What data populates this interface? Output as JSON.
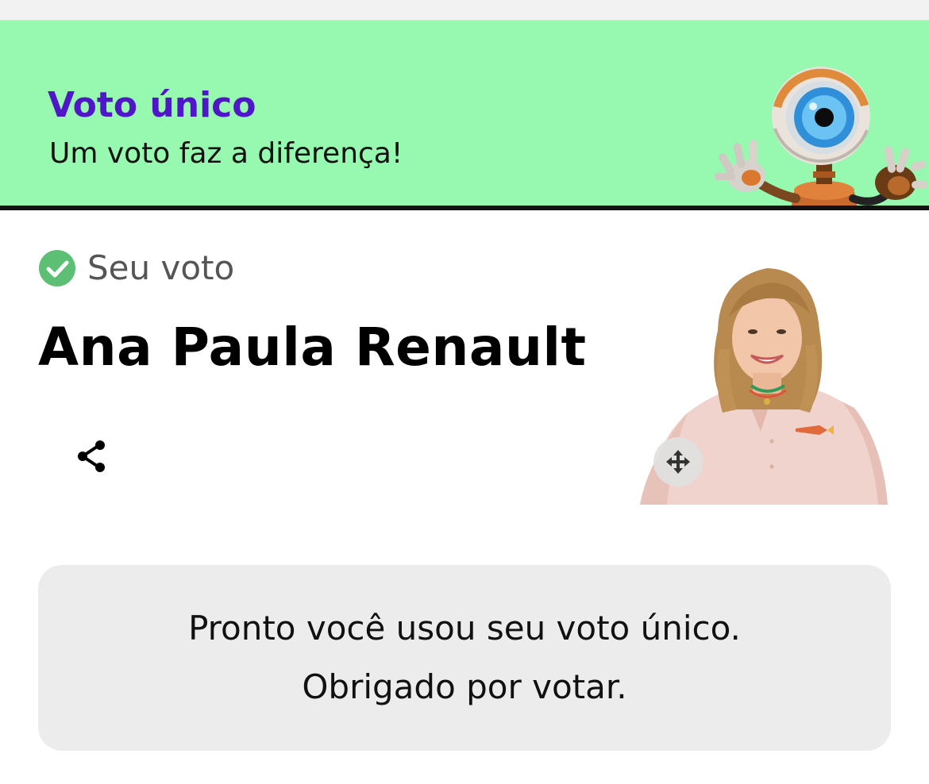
{
  "banner": {
    "title": "Voto único",
    "subtitle": "Um voto faz a diferença!",
    "mascot_icon": "big-brother-eye-robot-mascot",
    "background_color": "#97f8b0",
    "title_color": "#4f17c8"
  },
  "vote": {
    "status_icon": "check-circle-icon",
    "status_label": "Seu voto",
    "status_color": "#5cbf74",
    "candidate_name": "Ana Paula Renault"
  },
  "actions": {
    "share_icon": "share-icon",
    "move_icon": "move-arrows-icon"
  },
  "confirmation": {
    "line1": "Pronto você usou seu voto único.",
    "line2": "Obrigado por votar."
  }
}
